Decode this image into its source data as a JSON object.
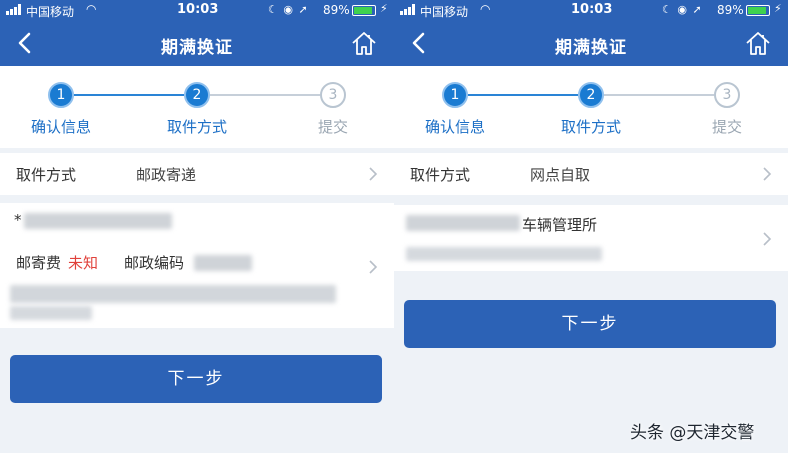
{
  "left": {
    "status": {
      "carrier": "中国移动",
      "time": "10:03",
      "battery": "89%",
      "battery_level": 0.89
    },
    "nav": {
      "title": "期满换证"
    },
    "stepper": {
      "steps": [
        {
          "number": "1",
          "label": "确认信息",
          "state": "done"
        },
        {
          "number": "2",
          "label": "取件方式",
          "state": "active"
        },
        {
          "number": "3",
          "label": "提交",
          "state": "pending"
        }
      ]
    },
    "method_row": {
      "label": "取件方式",
      "value": "邮政寄递"
    },
    "address": {
      "fee_label": "邮寄费",
      "fee_value": "未知",
      "postcode_label": "邮政编码",
      "name_prefix": "*"
    },
    "next_button": "下一步"
  },
  "right": {
    "status": {
      "carrier": "中国移动",
      "time": "10:03",
      "battery": "89%",
      "battery_level": 0.89
    },
    "nav": {
      "title": "期满换证"
    },
    "stepper": {
      "steps": [
        {
          "number": "1",
          "label": "确认信息",
          "state": "done"
        },
        {
          "number": "2",
          "label": "取件方式",
          "state": "active"
        },
        {
          "number": "3",
          "label": "提交",
          "state": "pending"
        }
      ]
    },
    "method_row": {
      "label": "取件方式",
      "value": "网点自取"
    },
    "location": {
      "name_suffix": "车辆管理所"
    },
    "next_button": "下一步"
  },
  "watermark": "头条 @天津交警",
  "colors": {
    "header": "#2c62b6",
    "accent": "#1a7bd2",
    "fee_unknown": "#e0413b",
    "background": "#eef2f7"
  }
}
